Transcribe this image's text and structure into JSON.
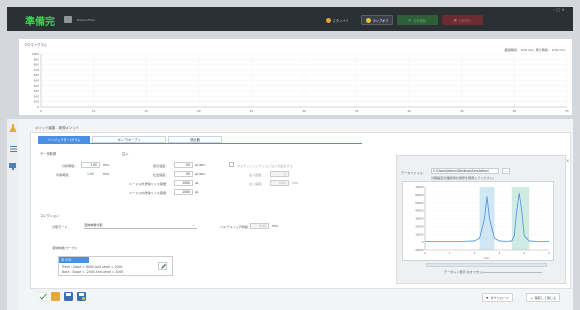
{
  "titlebar": {
    "status": "準備完",
    "app_name": "NeuronFlow",
    "standby_label": "スタンバイ",
    "lamp_label": "ランプオフ",
    "start_label": "分析開始",
    "stop_label": "分析停止",
    "window_controls": "– □ ×"
  },
  "chromatogram": {
    "label": "クロマトグラム",
    "time_readout": "経過時間： 0.00 min. 残り時間： 0.00 min.",
    "y_ticks": [
      "1000",
      "900",
      "800",
      "700",
      "600",
      "500",
      "400",
      "300",
      "200",
      "100",
      "0"
    ],
    "x_ticks": [
      "0",
      "10",
      "15",
      "20",
      "25",
      "30",
      "35",
      "40",
      "45",
      "50",
      "55"
    ]
  },
  "breadcrumb": "メソッド編集 - 新規メソッド",
  "tabs": [
    "インジェクター/カラム",
    "ポンプ/オーブン",
    "検出器"
  ],
  "analysis": {
    "section_label": "データ取得",
    "analysis_time_label": "分析時間：",
    "analysis_time_value": "1.00",
    "analysis_time_unit": "min.",
    "eq_time_label": "平衡時間：",
    "eq_time_value": "1.00",
    "eq_time_unit": "min."
  },
  "injection": {
    "section_label": "注入",
    "aspirate_label": "吸引速度：",
    "aspirate_value": "50",
    "aspirate_unit": "µL/sec.",
    "dispense_label": "吐出速度：",
    "dispense_value": "50",
    "dispense_unit": "µL/sec.",
    "wash_out_label": "ニードル外洗浄リンス容量：",
    "wash_out_value": "1000",
    "wash_out_unit": "µL",
    "wash_in_label": "ニードル内洗浄リンス容量：",
    "wash_in_value": "1000",
    "wash_in_unit": "µL",
    "multi_check_label": "マルチインジェクション注入を設定する",
    "count_label": "注入回数：",
    "count_value": "2",
    "interval_label": "注入間隔：",
    "interval_value": "0.01",
    "interval_unit": "min."
  },
  "collection": {
    "section_label": "コレクション",
    "mode_label": "分取モード：",
    "mode_value": "液体体積分取",
    "wait_label": "バルブスイッチ時間：",
    "wait_value": "0.00",
    "wait_unit": "min.",
    "list_label": "液体体積(ワーク):",
    "list_item": "ID CH1",
    "front_text": "Front : Slope = 8000 And Level = 1000",
    "back_text": "Back : Slope = -2000 And Level = 1000"
  },
  "data_file": {
    "label": "データファイル：",
    "path": "C:\\Users\\Admin\\Desktop\\Simulation\\",
    "hint": "分取設定の確認用の波形を使用してください。"
  },
  "graph": {
    "y_ticks": [
      "70000",
      "60000",
      "50000",
      "40000",
      "30000",
      "20000",
      "10000",
      "0",
      "-10000"
    ],
    "x_ticks": [
      "0",
      "1",
      "2",
      "3",
      "4",
      "5"
    ],
    "x_unit": "min.",
    "slider_label": "データレイ表示:大オフセット"
  },
  "chart_data": {
    "type": "line",
    "x": [
      0,
      0.5,
      1,
      1.5,
      2,
      2.2,
      2.4,
      2.5,
      2.6,
      2.8,
      3,
      3.3,
      3.5,
      3.6,
      3.7,
      3.8,
      3.9,
      4,
      4.2,
      4.5,
      5
    ],
    "y": [
      1000,
      1000,
      1000,
      1000,
      1500,
      5000,
      30000,
      58000,
      30000,
      5000,
      1500,
      1000,
      1500,
      8000,
      40000,
      62000,
      40000,
      8000,
      1500,
      1000,
      1000
    ],
    "xlim": [
      0,
      5
    ],
    "ylim": [
      -10000,
      70000
    ],
    "shaded_ranges": [
      [
        2.2,
        2.8
      ],
      [
        3.5,
        4.2
      ]
    ]
  },
  "footer": {
    "download_label": "ダウンロード",
    "close_label": "保存して閉じる"
  },
  "colors": {
    "accent": "#4a90e2",
    "ok": "#39d353",
    "shade": "#cfe6f5",
    "shade2": "#cdebe3"
  }
}
